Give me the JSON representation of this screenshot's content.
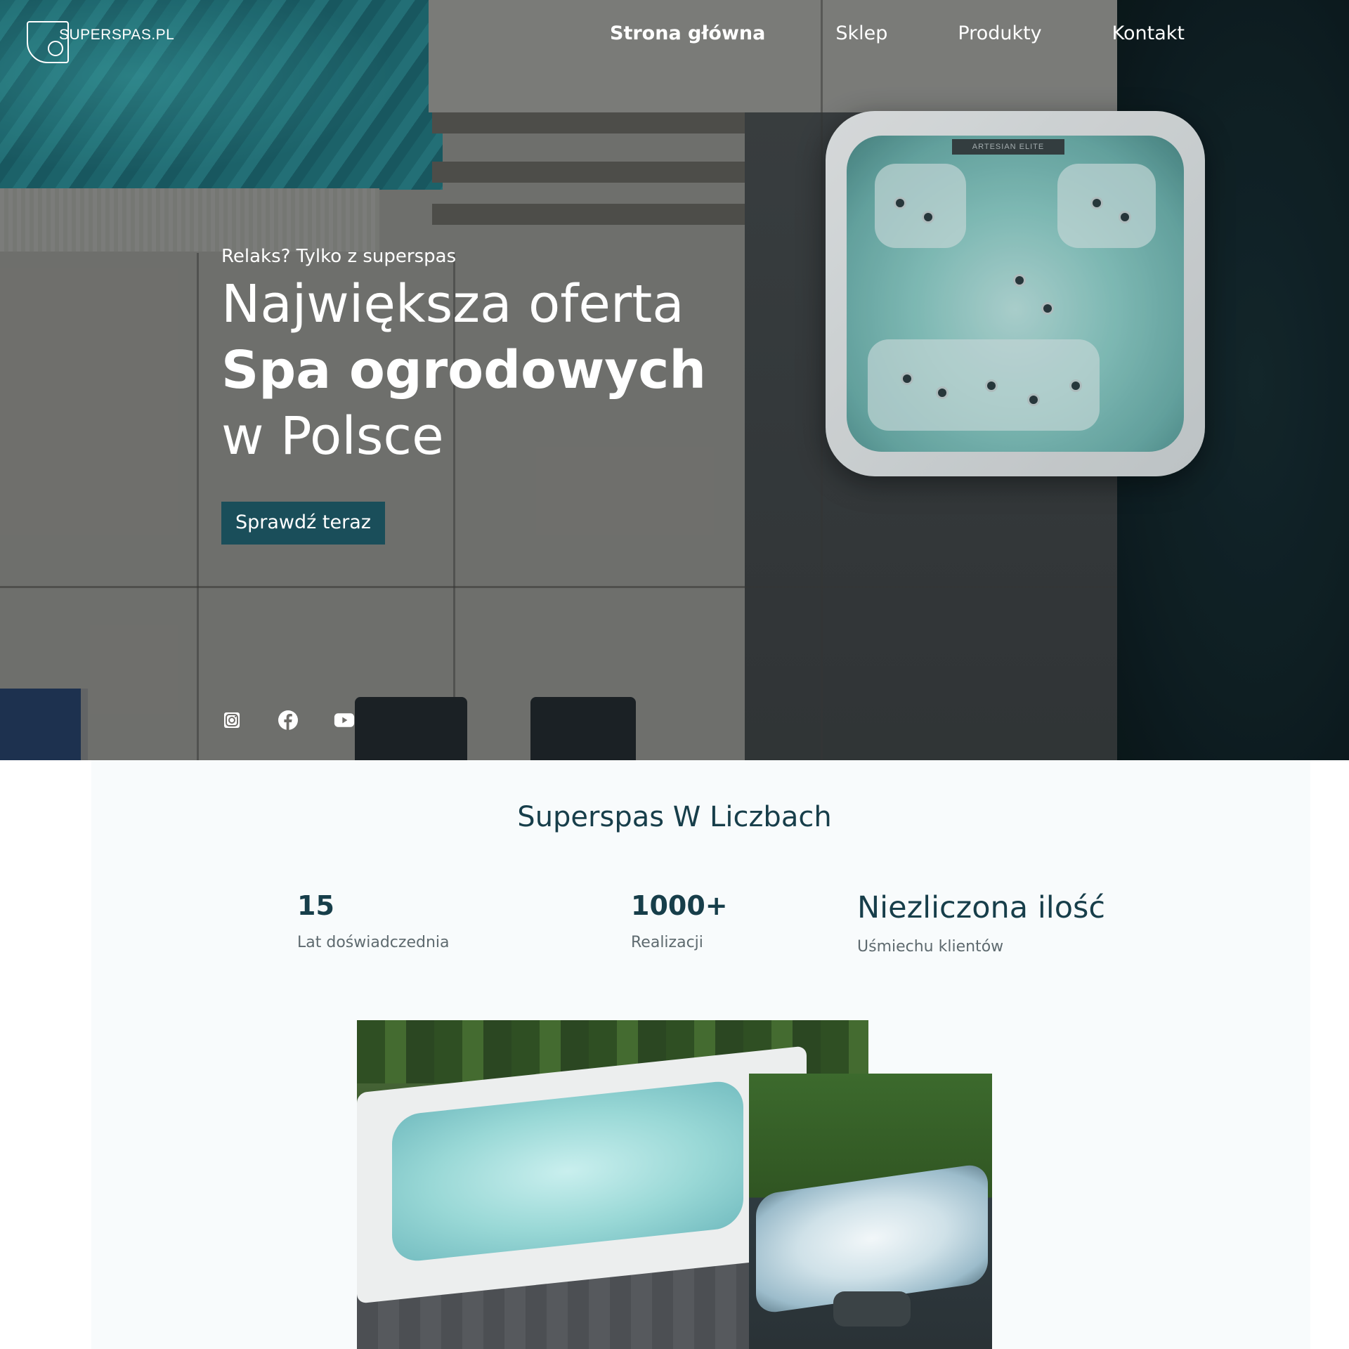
{
  "header": {
    "logo_text": "SUPERSPAS.PL",
    "nav": [
      {
        "label": "Strona główna",
        "active": true
      },
      {
        "label": "Sklep",
        "active": false
      },
      {
        "label": "Produkty",
        "active": false
      },
      {
        "label": "Kontakt",
        "active": false
      }
    ]
  },
  "hero": {
    "eyebrow": "Relaks? Tylko z superspas",
    "headline_line1": "Największa oferta",
    "headline_line2": "Spa ogrodowych",
    "headline_line3": "w Polsce",
    "cta_label": "Sprawdź teraz",
    "tub_badge": "ARTESIAN ELITE",
    "socials": [
      "instagram-icon",
      "facebook-icon",
      "youtube-icon"
    ]
  },
  "stats": {
    "title": "Superspas W Liczbach",
    "items": [
      {
        "value": "15",
        "label": "Lat doświadczednia"
      },
      {
        "value": "1000+",
        "label": "Realizacji"
      },
      {
        "value": "Niezliczona ilość",
        "label": "Uśmiechu klientów"
      }
    ]
  },
  "colors": {
    "accent": "#1a4e5a",
    "heading": "#173e4a",
    "muted_text": "#5e6a6f",
    "section_bg": "#f8fbfc"
  }
}
